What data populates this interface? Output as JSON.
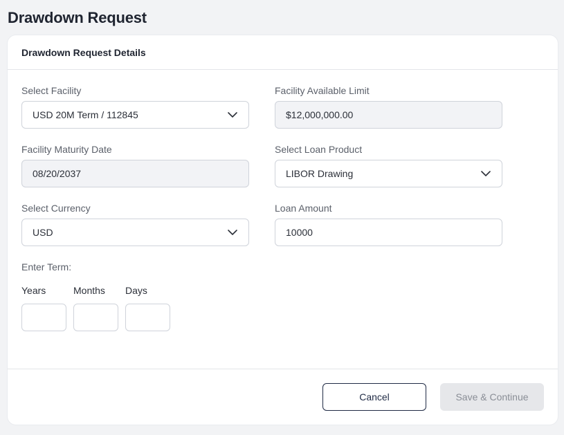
{
  "page": {
    "title": "Drawdown Request"
  },
  "card": {
    "header": "Drawdown Request Details"
  },
  "fields": {
    "facility": {
      "label": "Select Facility",
      "value": "USD 20M Term / 112845"
    },
    "available_limit": {
      "label": "Facility Available Limit",
      "value": "$12,000,000.00"
    },
    "maturity_date": {
      "label": "Facility Maturity Date",
      "value": "08/20/2037"
    },
    "loan_product": {
      "label": "Select Loan Product",
      "value": "LIBOR Drawing"
    },
    "currency": {
      "label": "Select Currency",
      "value": "USD"
    },
    "loan_amount": {
      "label": "Loan Amount",
      "value": "10000"
    }
  },
  "term": {
    "label": "Enter Term:",
    "years_label": "Years",
    "months_label": "Months",
    "days_label": "Days",
    "years_value": "",
    "months_value": "",
    "days_value": ""
  },
  "actions": {
    "cancel_label": "Cancel",
    "save_label": "Save & Continue"
  },
  "icons": {
    "dropdown": "chevron-down-icon"
  },
  "colors": {
    "primary_border": "#1f2a44",
    "disabled_bg": "#e6e7ea",
    "readonly_bg": "#f2f3f6",
    "page_bg": "#f2f3f5"
  }
}
